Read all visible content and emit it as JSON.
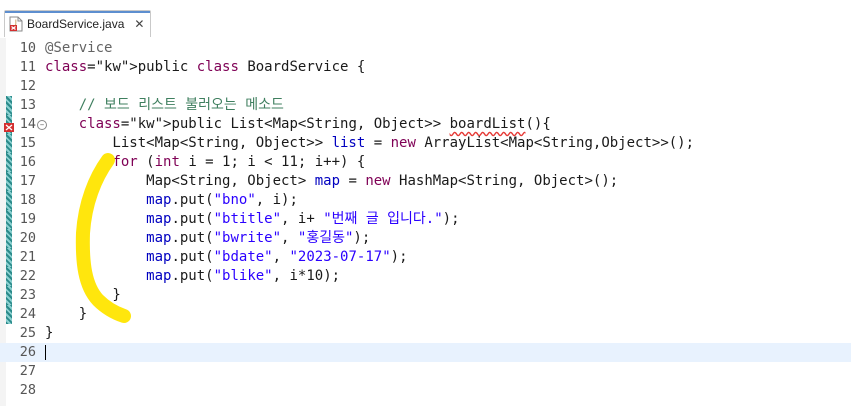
{
  "tab": {
    "title": "BoardService.java",
    "close": "✕",
    "icon": "java-file-error-icon"
  },
  "editor": {
    "current_line": 26,
    "lines": [
      {
        "n": "10",
        "code": "@Service"
      },
      {
        "n": "11",
        "code": "public class BoardService {"
      },
      {
        "n": "12",
        "code": ""
      },
      {
        "n": "13",
        "code": "    // 보드 리스트 불러오는 메소드"
      },
      {
        "n": "14",
        "code": "    public List<Map<String, Object>> boardList(){"
      },
      {
        "n": "15",
        "code": "        List<Map<String, Object>> list = new ArrayList<Map<String,Object>>();"
      },
      {
        "n": "16",
        "code": "        for (int i = 1; i < 11; i++) {"
      },
      {
        "n": "17",
        "code": "            Map<String, Object> map = new HashMap<String, Object>();"
      },
      {
        "n": "18",
        "code": "            map.put(\"bno\", i);"
      },
      {
        "n": "19",
        "code": "            map.put(\"btitle\", i+ \"번째 글 입니다.\");"
      },
      {
        "n": "20",
        "code": "            map.put(\"bwrite\", \"홍길동\");"
      },
      {
        "n": "21",
        "code": "            map.put(\"bdate\", \"2023-07-17\");"
      },
      {
        "n": "22",
        "code": "            map.put(\"blike\", i*10);"
      },
      {
        "n": "23",
        "code": "        }"
      },
      {
        "n": "24",
        "code": "    }"
      },
      {
        "n": "25",
        "code": "}"
      },
      {
        "n": "26",
        "code": ""
      },
      {
        "n": "27",
        "code": ""
      },
      {
        "n": "28",
        "code": ""
      }
    ]
  },
  "colors": {
    "keyword": "#7f0055",
    "string": "#2a00ff",
    "comment": "#3f7f5f",
    "annotation": "#646464",
    "current_line": "#e8f2fe",
    "highlighter": "#ffe500"
  }
}
